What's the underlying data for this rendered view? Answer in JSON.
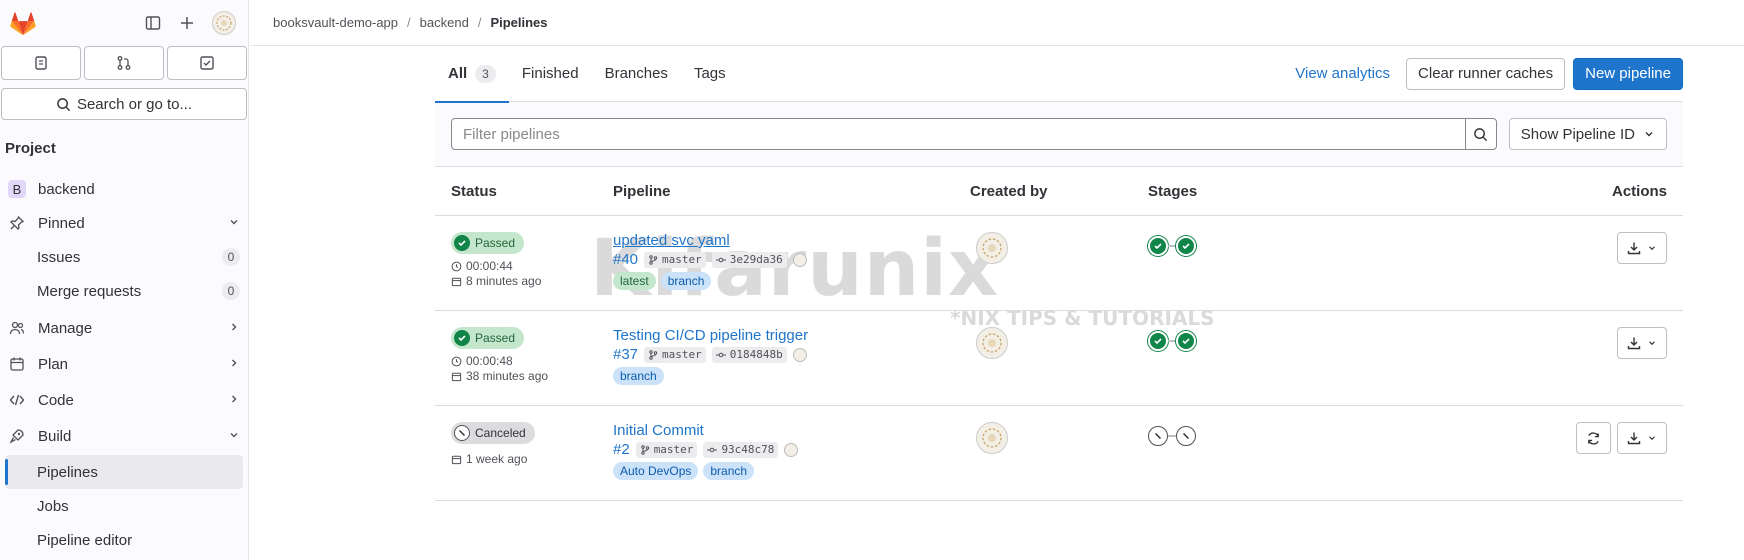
{
  "breadcrumb": [
    "booksvault-demo-app",
    "backend",
    "Pipelines"
  ],
  "sidebar": {
    "search_label": "Search or go to...",
    "section_title": "Project",
    "project_name": "backend",
    "project_initial": "B",
    "pinned_label": "Pinned",
    "issues_label": "Issues",
    "issues_count": "0",
    "mr_label": "Merge requests",
    "mr_count": "0",
    "manage_label": "Manage",
    "plan_label": "Plan",
    "code_label": "Code",
    "build_label": "Build",
    "pipelines_label": "Pipelines",
    "jobs_label": "Jobs",
    "editor_label": "Pipeline editor"
  },
  "tabs": {
    "all": "All",
    "all_count": "3",
    "finished": "Finished",
    "branches": "Branches",
    "tags": "Tags"
  },
  "actions": {
    "view_analytics": "View analytics",
    "clear_caches": "Clear runner caches",
    "new_pipeline": "New pipeline"
  },
  "filter": {
    "placeholder": "Filter pipelines",
    "show_id": "Show Pipeline ID"
  },
  "table": {
    "headers": {
      "status": "Status",
      "pipeline": "Pipeline",
      "created_by": "Created by",
      "stages": "Stages",
      "actions": "Actions"
    },
    "rows": [
      {
        "status": "Passed",
        "duration": "00:00:44",
        "finished": "8 minutes ago",
        "title": "updated svc yaml",
        "id": "#40",
        "branch": "master",
        "commit": "3e29da36",
        "tag1": "latest",
        "tag2": "branch"
      },
      {
        "status": "Passed",
        "duration": "00:00:48",
        "finished": "38 minutes ago",
        "title": "Testing CI/CD pipeline trigger",
        "id": "#37",
        "branch": "master",
        "commit": "0184848b",
        "tag1": "branch"
      },
      {
        "status": "Canceled",
        "finished": "1 week ago",
        "title": "Initial Commit",
        "id": "#2",
        "branch": "master",
        "commit": "93c48c78",
        "tag1": "Auto DevOps",
        "tag2": "branch"
      }
    ]
  },
  "watermark": {
    "main": "Kifarunix",
    "sub": "*NIX TIPS & TUTORIALS"
  },
  "colors": {
    "accent": "#1f75cb",
    "success": "#108548",
    "brand": "#e24329"
  }
}
